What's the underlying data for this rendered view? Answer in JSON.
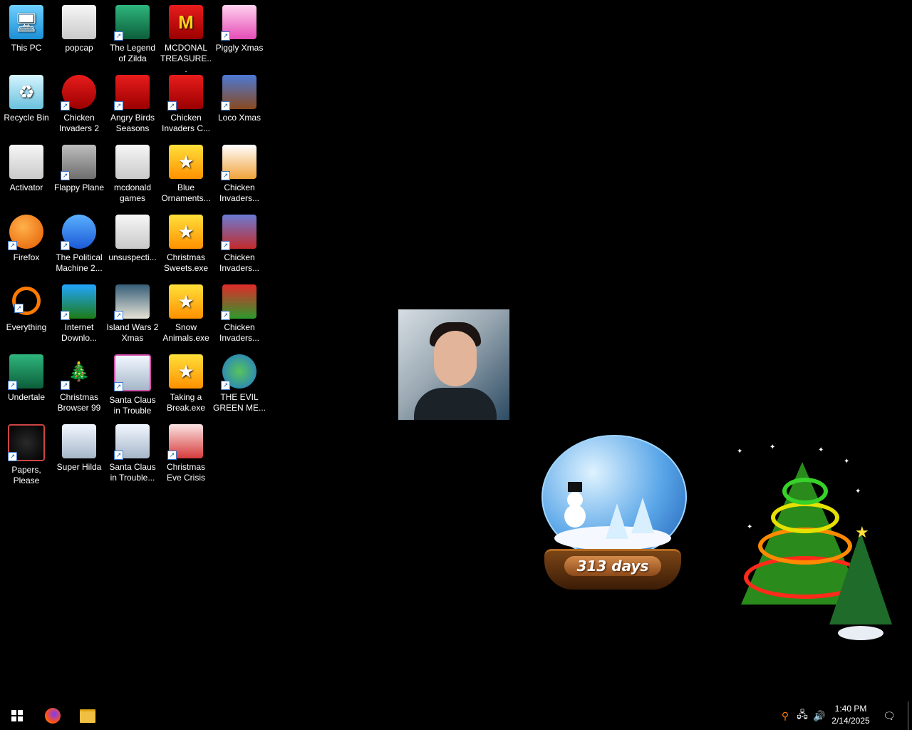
{
  "desktop": {
    "icons": [
      {
        "label": "This PC"
      },
      {
        "label": "popcap"
      },
      {
        "label": "The Legend of Zilda"
      },
      {
        "label": "MCDONAL TREASURE..."
      },
      {
        "label": "Piggly Xmas"
      },
      {
        "label": "Recycle Bin"
      },
      {
        "label": "Chicken Invaders 2"
      },
      {
        "label": "Angry Birds Seasons"
      },
      {
        "label": "Chicken Invaders C..."
      },
      {
        "label": "Loco Xmas"
      },
      {
        "label": "Activator"
      },
      {
        "label": "Flappy Plane"
      },
      {
        "label": "mcdonald games"
      },
      {
        "label": "Blue Ornaments..."
      },
      {
        "label": "Chicken Invaders..."
      },
      {
        "label": "Firefox"
      },
      {
        "label": "The Political Machine 2..."
      },
      {
        "label": "unsuspecti..."
      },
      {
        "label": "Christmas Sweets.exe"
      },
      {
        "label": "Chicken Invaders..."
      },
      {
        "label": "Everything"
      },
      {
        "label": "Internet Downlo..."
      },
      {
        "label": "Island Wars 2 Xmas"
      },
      {
        "label": "Snow Animals.exe"
      },
      {
        "label": "Chicken Invaders..."
      },
      {
        "label": "Undertale"
      },
      {
        "label": "Christmas Browser 99"
      },
      {
        "label": "Santa Claus in Trouble"
      },
      {
        "label": "Taking a Break.exe"
      },
      {
        "label": "THE EVIL GREEN ME..."
      },
      {
        "label": "Papers, Please"
      },
      {
        "label": "Super Hilda"
      },
      {
        "label": "Santa Claus in Trouble..."
      },
      {
        "label": "Christmas Eve Crisis"
      }
    ]
  },
  "widgets": {
    "snow_globe": {
      "countdown": "313 days"
    }
  },
  "taskbar": {
    "clock_time": "1:40 PM",
    "clock_date": "2/14/2025",
    "icons": [
      "windows-start-icon",
      "firefox-icon",
      "file-explorer-icon",
      "search-tool-icon",
      "network-icon",
      "volume-icon",
      "notification-icon"
    ]
  }
}
